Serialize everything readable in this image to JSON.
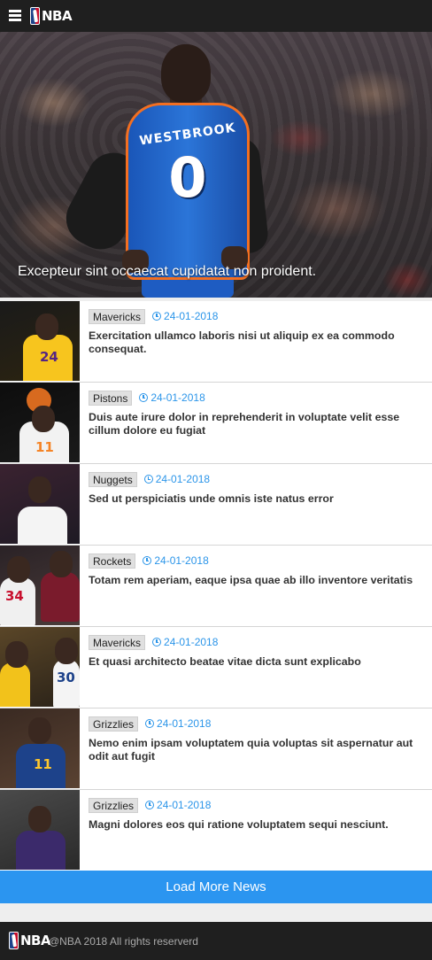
{
  "header": {
    "menu_icon": "hamburger-menu-icon",
    "logo_text": "NBA"
  },
  "hero": {
    "caption": "Excepteur sint occaecat cupidatat non proident.",
    "jersey_name": "WESTBROOK",
    "jersey_number": "0",
    "colors": {
      "jersey": "#2b75d8",
      "trim": "#f36f21"
    }
  },
  "news": [
    {
      "team": "Mavericks",
      "date": "24-01-2018",
      "title": "Exercitation ullamco laboris nisi ut aliquip ex ea commodo consequat.",
      "jersey": "24"
    },
    {
      "team": "Pistons",
      "date": "24-01-2018",
      "title": "Duis aute irure dolor in reprehenderit in voluptate velit esse cillum dolore eu fugiat",
      "jersey": "11"
    },
    {
      "team": "Nuggets",
      "date": "24-01-2018",
      "title": "Sed ut perspiciatis unde omnis iste natus error",
      "jersey": ""
    },
    {
      "team": "Rockets",
      "date": "24-01-2018",
      "title": "Totam rem aperiam, eaque ipsa quae ab illo inventore veritatis",
      "jersey": "34"
    },
    {
      "team": "Mavericks",
      "date": "24-01-2018",
      "title": "Et quasi architecto beatae vitae dicta sunt explicabo",
      "jersey": "30"
    },
    {
      "team": "Grizzlies",
      "date": "24-01-2018",
      "title": "Nemo enim ipsam voluptatem quia voluptas sit aspernatur aut odit aut fugit",
      "jersey": "11"
    },
    {
      "team": "Grizzlies",
      "date": "24-01-2018",
      "title": "Magni dolores eos qui ratione voluptatem sequi nesciunt.",
      "jersey": ""
    }
  ],
  "load_more_label": "Load More News",
  "footer": {
    "logo_text": "NBA",
    "copyright": "@NBA 2018 All rights reserverd"
  },
  "colors": {
    "accent": "#2b95f0",
    "date": "#2b95e9",
    "header_bg": "#1f1f1f"
  }
}
